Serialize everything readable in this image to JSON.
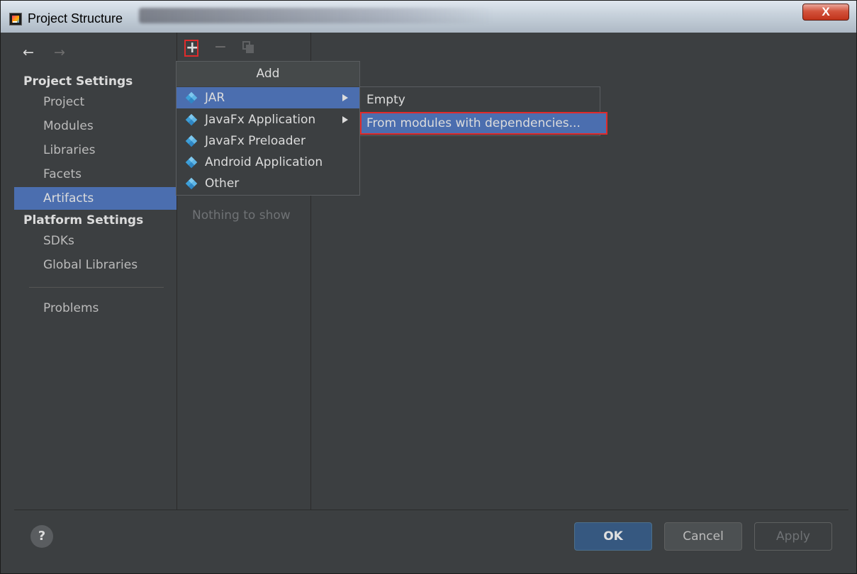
{
  "window": {
    "title": "Project Structure",
    "close_label": "X"
  },
  "nav": {
    "back": "←",
    "forward": "→"
  },
  "sidebar": {
    "project_settings_title": "Project Settings",
    "project_items": [
      "Project",
      "Modules",
      "Libraries",
      "Facets",
      "Artifacts"
    ],
    "selected": "Artifacts",
    "platform_settings_title": "Platform Settings",
    "platform_items": [
      "SDKs",
      "Global Libraries"
    ],
    "problems": "Problems"
  },
  "toolbar": {
    "add": "+",
    "remove": "−"
  },
  "middle": {
    "empty_text": "Nothing to show"
  },
  "add_menu": {
    "header": "Add",
    "items": [
      "JAR",
      "JavaFx Application",
      "JavaFx Preloader",
      "Android Application",
      "Other"
    ]
  },
  "jar_submenu": {
    "items": [
      "Empty",
      "From modules with dependencies..."
    ]
  },
  "footer": {
    "help": "?",
    "ok": "OK",
    "cancel": "Cancel",
    "apply": "Apply"
  },
  "colors": {
    "background": "#3c3f41",
    "selection": "#4b6eaf",
    "highlight_border": "#e02b2b",
    "ok_button": "#365880"
  }
}
